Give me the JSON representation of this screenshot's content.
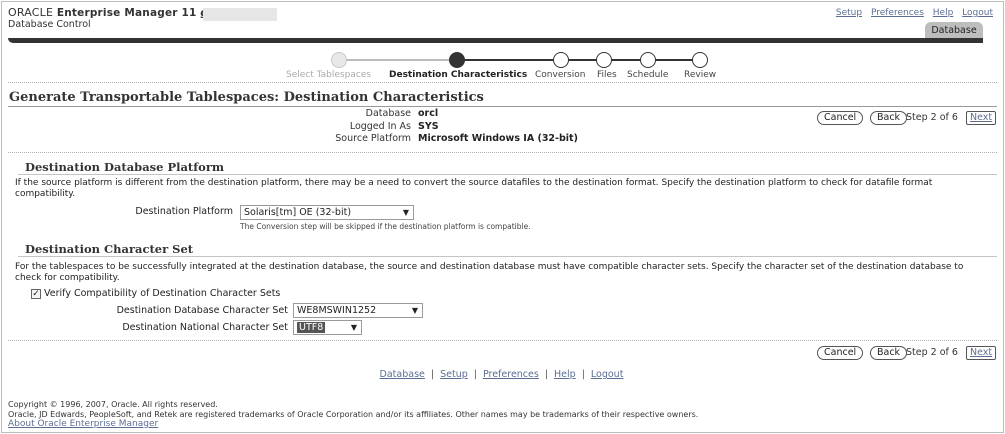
{
  "header": {
    "logo_oracle": "ORACLE",
    "logo_product": "Enterprise Manager 11",
    "logo_version": "g",
    "subtitle": "Database Control",
    "links": [
      "Setup",
      "Preferences",
      "Help",
      "Logout"
    ],
    "active_tab": "Database"
  },
  "train": {
    "steps": [
      "Select Tablespaces",
      "Destination Characteristics",
      "Conversion",
      "Files",
      "Schedule",
      "Review"
    ]
  },
  "page": {
    "title": "Generate Transportable Tablespaces: Destination Characteristics"
  },
  "info": {
    "database_label": "Database",
    "database_value": "orcl",
    "logged_label": "Logged In As",
    "logged_value": "SYS",
    "platform_label": "Source Platform",
    "platform_value": "Microsoft Windows IA (32-bit)"
  },
  "nav": {
    "cancel": "Cancel",
    "back": "Back",
    "step_text": "Step 2 of 6",
    "next": "Next"
  },
  "platform_section": {
    "heading": "Destination Database Platform",
    "description": "If the source platform is different from the destination platform, there may be a need to convert the source datafiles to the destination format. Specify the destination platform to check for datafile format compatibility.",
    "field_label": "Destination Platform",
    "field_value": "Solaris[tm] OE (32-bit)",
    "hint": "The Conversion step will be skipped if the destination platform is compatible."
  },
  "charset_section": {
    "heading": "Destination Character Set",
    "description": "For the tablespaces to be successfully integrated at the destination database, the source and destination database must have compatible character sets. Specify the character set of the destination database to check for compatibility.",
    "verify_label": "Verify Compatibility of Destination Character Sets",
    "verify_checked": true,
    "db_charset_label": "Destination Database Character Set",
    "db_charset_value": "WE8MSWIN1252",
    "national_label": "Destination National Character Set",
    "national_value": "UTF8"
  },
  "footer": {
    "links": [
      "Database",
      "Setup",
      "Preferences",
      "Help",
      "Logout"
    ],
    "copyright_line1": "Copyright © 1996, 2007, Oracle. All rights reserved.",
    "copyright_line2": "Oracle, JD Edwards, PeopleSoft, and Retek are registered trademarks of Oracle Corporation and/or its affiliates. Other names may be trademarks of their respective owners.",
    "about": "About Oracle Enterprise Manager"
  }
}
